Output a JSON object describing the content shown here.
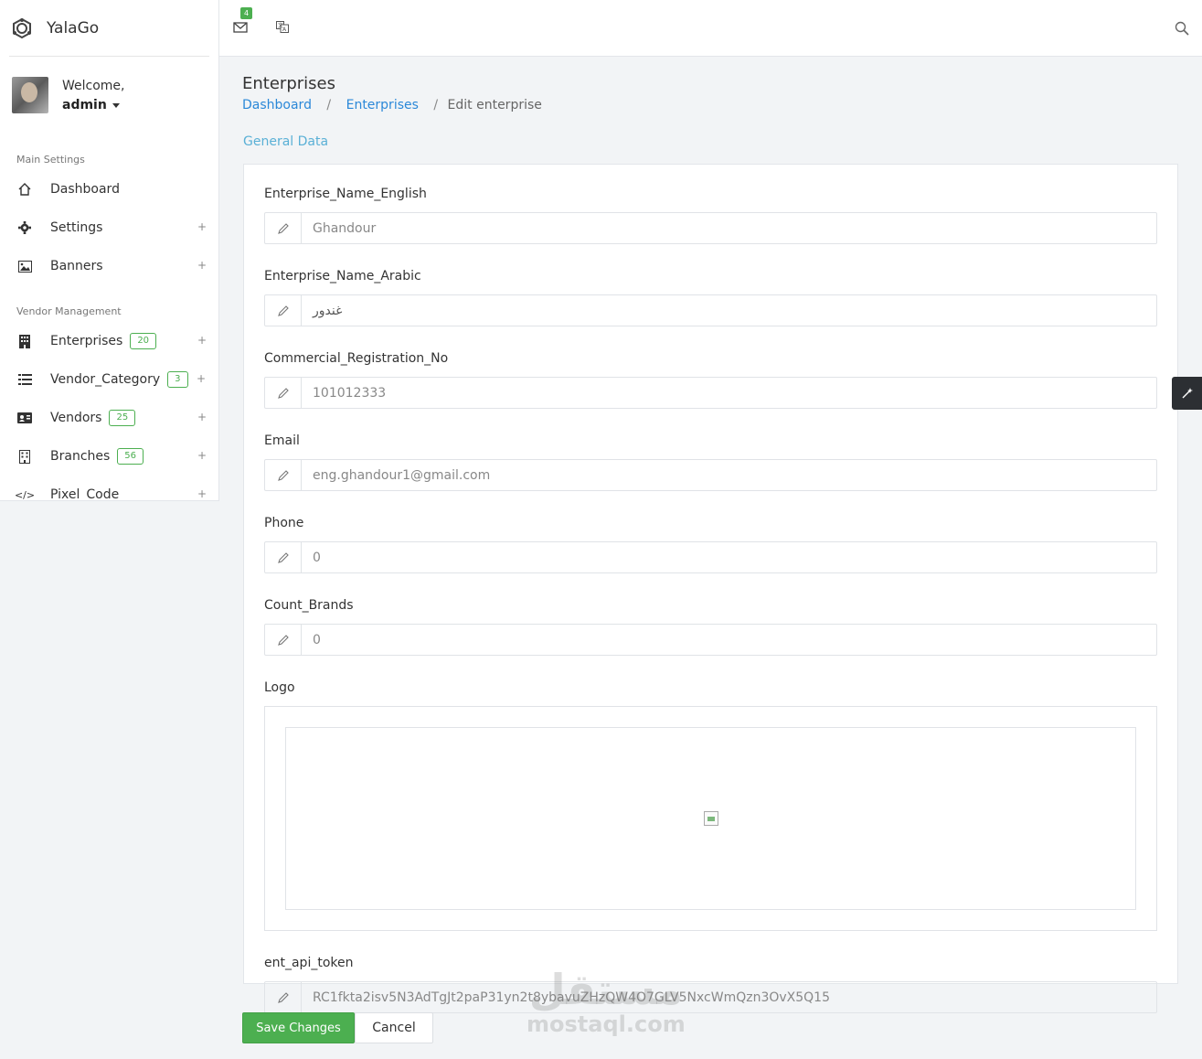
{
  "app": {
    "name": "YalaGo"
  },
  "user": {
    "welcome": "Welcome,",
    "name": "admin"
  },
  "sidebar": {
    "sections": [
      {
        "title": "Main Settings"
      },
      {
        "title": "Vendor Management"
      }
    ],
    "items": [
      {
        "label": "Dashboard",
        "icon": "home-icon"
      },
      {
        "label": "Settings",
        "icon": "gear-icon",
        "plus": "+"
      },
      {
        "label": "Banners",
        "icon": "image-icon",
        "plus": "+"
      },
      {
        "label": "Enterprises",
        "icon": "building-icon",
        "badge": "20",
        "plus": "+"
      },
      {
        "label": "Vendor_Category",
        "icon": "list-icon",
        "badge": "3",
        "plus": "+"
      },
      {
        "label": "Vendors",
        "icon": "id-card-icon",
        "badge": "25",
        "plus": "+"
      },
      {
        "label": "Branches",
        "icon": "office-icon",
        "badge": "56",
        "plus": "+"
      },
      {
        "label": "Pixel_Code",
        "icon": "code-icon",
        "plus": "+"
      }
    ]
  },
  "topbar": {
    "mail_count": "4",
    "lang_icon": "translate-icon"
  },
  "page": {
    "title": "Enterprises",
    "breadcrumb": {
      "home": "Dashboard",
      "section": "Enterprises",
      "current": "Edit enterprise"
    },
    "section_label": "General Data"
  },
  "form": {
    "fields": [
      {
        "label": "Enterprise_Name_English",
        "value": "Ghandour"
      },
      {
        "label": "Enterprise_Name_Arabic",
        "value": "غندور"
      },
      {
        "label": "Commercial_Registration_No",
        "value": "101012333"
      },
      {
        "label": "Email",
        "value": "eng.ghandour1@gmail.com"
      },
      {
        "label": "Phone",
        "value": "0"
      },
      {
        "label": "Count_Brands",
        "value": "0"
      }
    ],
    "logo_label": "Logo",
    "token": {
      "label": "ent_api_token",
      "value": "RC1fkta2isv5N3AdTgJt2paP31yn2t8ybavuZHzQW4O7GLV5NxcWmQzn3OvX5Q15"
    }
  },
  "actions": {
    "save": "Save Changes",
    "cancel": "Cancel"
  },
  "watermark": {
    "arabic": "مستقل",
    "latin": "mostaql.com"
  },
  "colors": {
    "accent": "#4caf50",
    "link": "#2b88d8",
    "section": "#5ab0d6"
  }
}
